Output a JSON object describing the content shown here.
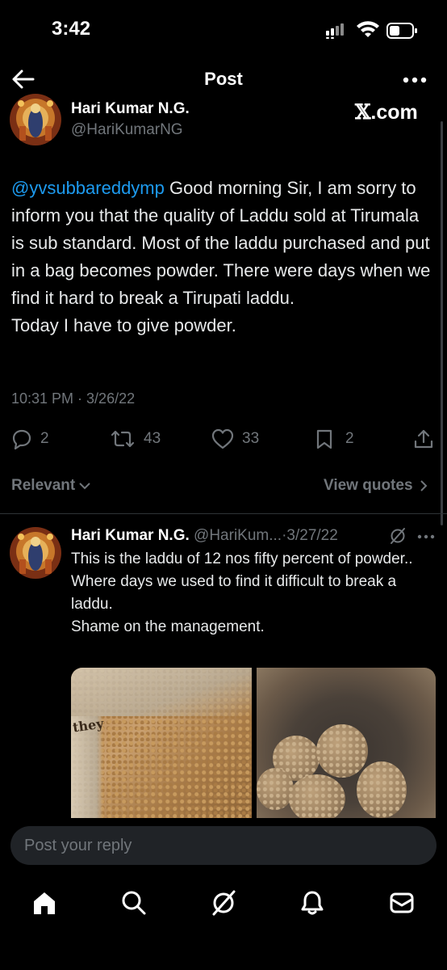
{
  "status_bar": {
    "time": "3:42"
  },
  "nav": {
    "title": "Post"
  },
  "post": {
    "author_name": "Hari Kumar N.G.",
    "author_handle": "@HariKumarNG",
    "source_badge": ".com",
    "mention": "@yvsubbareddymp",
    "body": " Good morning Sir, I am sorry to inform you that the quality of Laddu sold at Tirumala is sub standard. Most of the laddu purchased and put in a bag becomes powder. There were days when we find it hard to break a Tirupati laddu.\nToday I have to give powder.",
    "timestamp": "10:31 PM · 3/26/22",
    "replies": "2",
    "reposts": "43",
    "likes": "33",
    "bookmarks": "2"
  },
  "replies_section": {
    "sort_label": "Relevant",
    "view_quotes_label": "View quotes"
  },
  "reply": {
    "author_name": "Hari Kumar N.G.",
    "author_handle": "@HariKum...",
    "date": "·3/27/22",
    "text": "This is the laddu of 12 nos fifty percent of powder..\nWhere days we used to find it difficult to break a laddu.\nShame on the management.",
    "image_text": "they"
  },
  "composer": {
    "placeholder": "Post your reply"
  },
  "colors": {
    "accent": "#1d9bf0",
    "muted": "#71767b",
    "background": "#000000"
  },
  "icons": [
    "back-arrow-icon",
    "more-icon",
    "reply-icon",
    "repost-icon",
    "like-icon",
    "bookmark-icon",
    "share-icon",
    "grok-icon",
    "home-icon",
    "search-icon",
    "notifications-icon",
    "messages-icon"
  ]
}
